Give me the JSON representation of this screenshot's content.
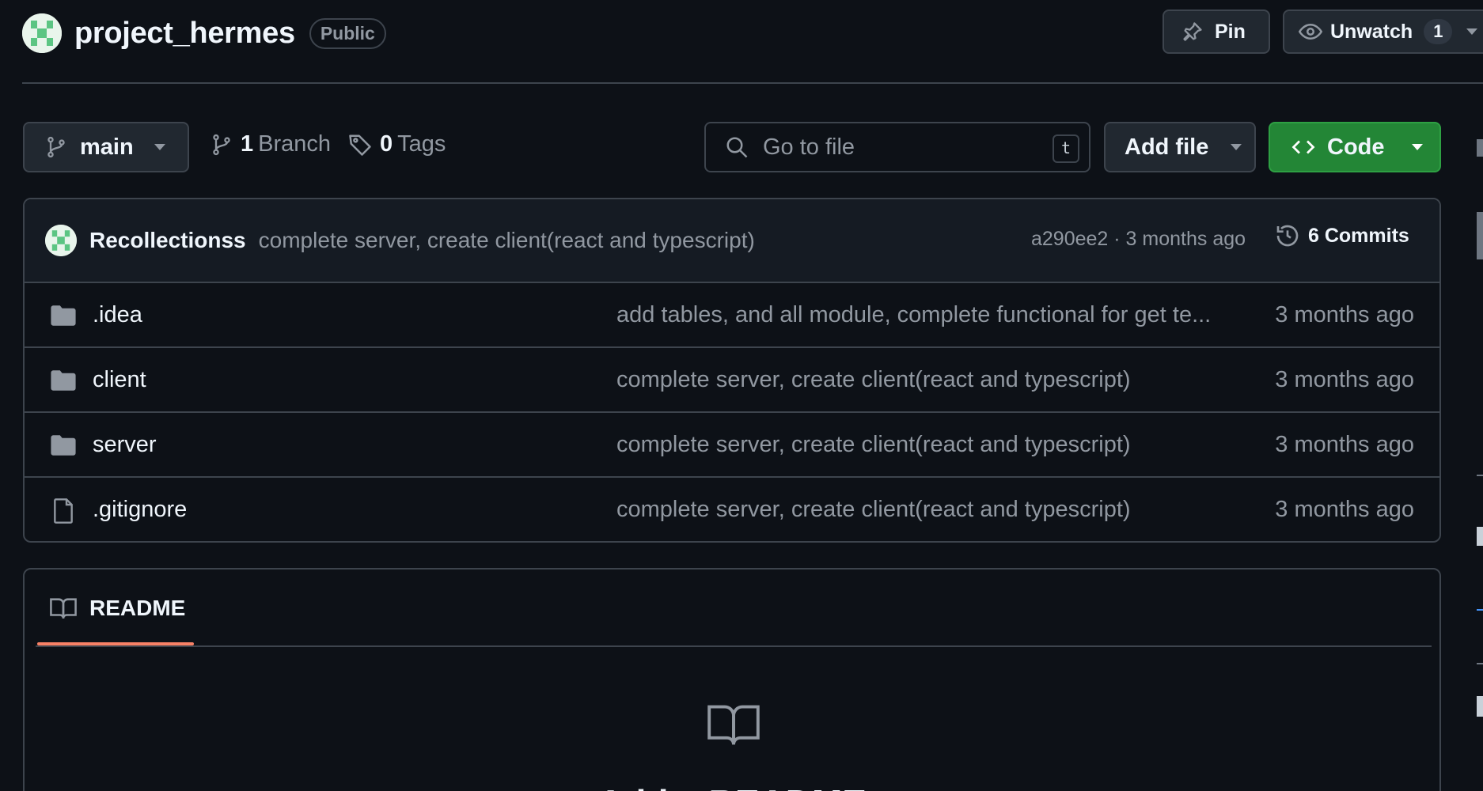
{
  "header": {
    "repo_name": "project_hermes",
    "visibility": "Public",
    "pin_label": "Pin",
    "watch_label": "Unwatch",
    "watch_count": "1"
  },
  "toolbar": {
    "branch": "main",
    "branch_count": "1",
    "branch_label": "Branch",
    "tag_count": "0",
    "tag_label": "Tags",
    "search_placeholder": "Go to file",
    "search_shortcut": "t",
    "add_file_label": "Add file",
    "code_label": "Code"
  },
  "latest_commit": {
    "author": "Recollectionss",
    "message": "complete server, create client(react and typescript)",
    "meta": "a290ee2 · 3 months ago",
    "commits_label": "6 Commits"
  },
  "files": [
    {
      "name": ".idea",
      "type": "folder",
      "message": "add tables, and all module, complete functional for get te...",
      "date": "3 months ago"
    },
    {
      "name": "client",
      "type": "folder",
      "message": "complete server, create client(react and typescript)",
      "date": "3 months ago"
    },
    {
      "name": "server",
      "type": "folder",
      "message": "complete server, create client(react and typescript)",
      "date": "3 months ago"
    },
    {
      "name": ".gitignore",
      "type": "file",
      "message": "complete server, create client(react and typescript)",
      "date": "3 months ago"
    }
  ],
  "readme": {
    "tab_label": "README",
    "add_label": "Add a README"
  },
  "colors": {
    "background": "#0d1117",
    "border": "#3d444d",
    "code_button": "#238636",
    "tab_underline": "#f78166"
  }
}
